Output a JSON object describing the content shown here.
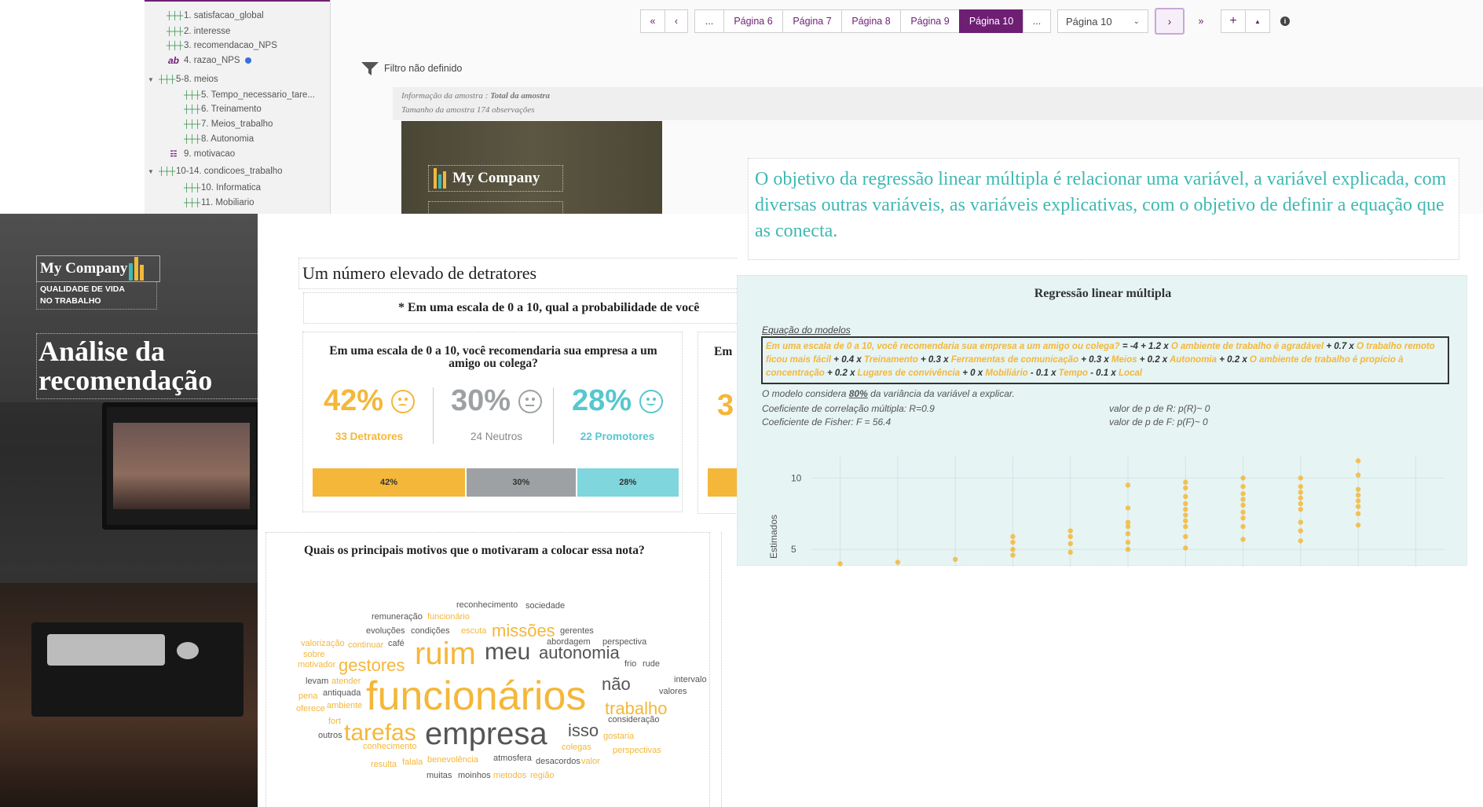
{
  "tree": {
    "items": [
      {
        "icon": "scale-icon",
        "label": "1. satisfacao_global"
      },
      {
        "icon": "scale-icon",
        "label": "2. interesse"
      },
      {
        "icon": "scale-icon",
        "label": "3. recomendacao_NPS"
      },
      {
        "icon": "text-icon",
        "label": "4. razao_NPS"
      },
      {
        "icon": "scale-icon",
        "label": "5-8. meios",
        "toggle": "▼"
      },
      {
        "icon": "scale-icon",
        "label": "5. Tempo_necessario_tare..."
      },
      {
        "icon": "scale-icon",
        "label": "6. Treinamento"
      },
      {
        "icon": "scale-icon",
        "label": "7. Meios_trabalho"
      },
      {
        "icon": "scale-icon",
        "label": "8. Autonomia"
      },
      {
        "icon": "multi-choice-icon",
        "label": "9. motivacao"
      },
      {
        "icon": "scale-icon",
        "label": "10-14. condicoes_trabalho",
        "toggle": "▼"
      },
      {
        "icon": "scale-icon",
        "label": "10. Informatica"
      },
      {
        "icon": "scale-icon",
        "label": "11. Mobiliario"
      }
    ]
  },
  "pager": {
    "first": "«",
    "prev": "‹",
    "ellipsis_left": "...",
    "pages": [
      "Página 6",
      "Página 7",
      "Página 8",
      "Página 9",
      "Página 10"
    ],
    "active_index": 4,
    "ellipsis_right": "...",
    "select_value": "Página 10",
    "next": "›",
    "last": "»",
    "add": "+",
    "collapse": "▲",
    "info": "i"
  },
  "filter": {
    "label": "Filtro não definido"
  },
  "sample": {
    "info_prefix": "Informação da amostra :",
    "info_value": "Total da amostra",
    "size": "Tamanho da amostra 174 observações"
  },
  "brand": {
    "company": "My Company",
    "sub_line1": "QUALIDADE DE VIDA",
    "sub_line2": "NO TRABALHO",
    "colors": [
      "#f4b73a",
      "#3fb9b3",
      "#6e1f74"
    ]
  },
  "cover": {
    "title": "Análise da recomendação"
  },
  "report": {
    "section_title": "Um número elevado de detratores",
    "question_full": "* Em uma escala de 0 a 10, qual a probabilidade de você",
    "nps": {
      "question": "Em uma escala de 0 a 10, você recomendaria sua empresa a um amigo ou colega?",
      "detractors": {
        "pct": "42%",
        "label": "33 Detratores",
        "value": 42,
        "color": "#f4b73a"
      },
      "neutrals": {
        "pct": "30%",
        "label": "24 Neutros",
        "value": 30,
        "color": "#9ea1a3"
      },
      "promoters": {
        "pct": "28%",
        "label": "22 Promotores",
        "value": 28,
        "color": "#7fd6dc"
      }
    },
    "cut_card": {
      "title": "Em",
      "number": "3"
    },
    "wordcloud_title": "Quais os principais motivos que o motivaram a colocar essa nota?",
    "words": [
      {
        "t": "reconhecimento",
        "c": "g",
        "s": 11
      },
      {
        "t": "sociedade",
        "c": "g",
        "s": 11
      },
      {
        "t": "remuneração",
        "c": "g",
        "s": 11
      },
      {
        "t": "funcionário",
        "c": "y",
        "s": 11
      },
      {
        "t": "evoluções",
        "c": "g",
        "s": 11
      },
      {
        "t": "condições",
        "c": "g",
        "s": 11
      },
      {
        "t": "escuta",
        "c": "y",
        "s": 11
      },
      {
        "t": "missões",
        "c": "y",
        "s": 22
      },
      {
        "t": "gerentes",
        "c": "g",
        "s": 11
      },
      {
        "t": "abordagem",
        "c": "g",
        "s": 11
      },
      {
        "t": "perspectiva",
        "c": "g",
        "s": 11
      },
      {
        "t": "valorização",
        "c": "y",
        "s": 11
      },
      {
        "t": "continuar",
        "c": "y",
        "s": 11
      },
      {
        "t": "café",
        "c": "g",
        "s": 11
      },
      {
        "t": "ruim",
        "c": "y",
        "s": 40
      },
      {
        "t": "meu",
        "c": "g",
        "s": 30
      },
      {
        "t": "autonomia",
        "c": "g",
        "s": 22
      },
      {
        "t": "sobre",
        "c": "y",
        "s": 11
      },
      {
        "t": "motivador",
        "c": "y",
        "s": 11
      },
      {
        "t": "gestores",
        "c": "y",
        "s": 22
      },
      {
        "t": "frio",
        "c": "g",
        "s": 11
      },
      {
        "t": "rude",
        "c": "g",
        "s": 11
      },
      {
        "t": "levam",
        "c": "g",
        "s": 11
      },
      {
        "t": "atender",
        "c": "y",
        "s": 11
      },
      {
        "t": "funcionários",
        "c": "y",
        "s": 52
      },
      {
        "t": "não",
        "c": "g",
        "s": 22
      },
      {
        "t": "intervalo",
        "c": "g",
        "s": 11
      },
      {
        "t": "pena",
        "c": "y",
        "s": 11
      },
      {
        "t": "antiquada",
        "c": "g",
        "s": 11
      },
      {
        "t": "valores",
        "c": "g",
        "s": 11
      },
      {
        "t": "oferece",
        "c": "y",
        "s": 11
      },
      {
        "t": "ambiente",
        "c": "y",
        "s": 11
      },
      {
        "t": "trabalho",
        "c": "y",
        "s": 22
      },
      {
        "t": "fort",
        "c": "y",
        "s": 11
      },
      {
        "t": "outros",
        "c": "g",
        "s": 11
      },
      {
        "t": "tarefas",
        "c": "y",
        "s": 30
      },
      {
        "t": "empresa",
        "c": "g",
        "s": 40
      },
      {
        "t": "isso",
        "c": "g",
        "s": 22
      },
      {
        "t": "consideração",
        "c": "g",
        "s": 11
      },
      {
        "t": "gostaria",
        "c": "y",
        "s": 11
      },
      {
        "t": "conhecimento",
        "c": "y",
        "s": 11
      },
      {
        "t": "colegas",
        "c": "y",
        "s": 11
      },
      {
        "t": "perspectivas",
        "c": "y",
        "s": 11
      },
      {
        "t": "benevolência",
        "c": "y",
        "s": 11
      },
      {
        "t": "atmosfera",
        "c": "g",
        "s": 11
      },
      {
        "t": "resulta",
        "c": "y",
        "s": 11
      },
      {
        "t": "falala",
        "c": "y",
        "s": 11
      },
      {
        "t": "desacordos",
        "c": "g",
        "s": 11
      },
      {
        "t": "valor",
        "c": "y",
        "s": 11
      },
      {
        "t": "muitas",
        "c": "g",
        "s": 11
      },
      {
        "t": "moinhos",
        "c": "g",
        "s": 11
      },
      {
        "t": "metodos",
        "c": "y",
        "s": 11
      },
      {
        "t": "região",
        "c": "y",
        "s": 11
      }
    ]
  },
  "regression": {
    "intro": "O objetivo da regressão linear múltipla é relacionar uma variável, a variável explicada, com diversas outras variáveis, as variáveis explicativas, com o objetivo de definir a equação que as conecta.",
    "title": "Regressão linear múltipla",
    "eq_label": "Equação do modelos",
    "eq": [
      {
        "t": "Em uma escala de 0 a 10, você recomendaria sua empresa a um amigo ou colega?",
        "k": "hl"
      },
      {
        "t": " = -4 + 1.2 x ",
        "k": "dk"
      },
      {
        "t": "O ambiente de trabalho é agradável",
        "k": "hl"
      },
      {
        "t": " + 0.7 x ",
        "k": "dk"
      },
      {
        "t": "O trabalho remoto ficou mais fácil",
        "k": "hl"
      },
      {
        "t": " + 0.4 x ",
        "k": "dk"
      },
      {
        "t": "Treinamento",
        "k": "hl"
      },
      {
        "t": " + 0.3 x ",
        "k": "dk"
      },
      {
        "t": "Ferramentas de comunicação",
        "k": "hl"
      },
      {
        "t": " + 0.3 x ",
        "k": "dk"
      },
      {
        "t": "Meios",
        "k": "hl"
      },
      {
        "t": " + 0.2 x ",
        "k": "dk"
      },
      {
        "t": "Autonomia",
        "k": "hl"
      },
      {
        "t": " + 0.2 x ",
        "k": "dk"
      },
      {
        "t": "O ambiente de trabalho é propício à concentração",
        "k": "hl"
      },
      {
        "t": " + 0.2 x ",
        "k": "dk"
      },
      {
        "t": "Lugares de convivência",
        "k": "hl"
      },
      {
        "t": " + 0 x ",
        "k": "dk"
      },
      {
        "t": "Mobiliário",
        "k": "hl"
      },
      {
        "t": " - 0.1 x ",
        "k": "dk"
      },
      {
        "t": "Tempo",
        "k": "hl"
      },
      {
        "t": " - 0.1 x ",
        "k": "dk"
      },
      {
        "t": "Local",
        "k": "hl"
      }
    ],
    "variance_prefix": "O modelo considera ",
    "variance_value": "80%",
    "variance_suffix": " da variância da variável a explicar.",
    "r_coef": "Coeficiente de correlação múltipla: R=0.9",
    "f_coef": "Coeficiente de Fisher: F = 56.4",
    "p_r": "valor de p de R: p(R)~ 0",
    "p_f": "valor de p de F: p(F)~ 0"
  },
  "chart_data": {
    "type": "scatter",
    "title": "",
    "xlabel": "",
    "ylabel": "Estimados",
    "ylim": [
      3.8,
      11.5
    ],
    "xlim": [
      -0.5,
      10.5
    ],
    "yticks": [
      5,
      10
    ],
    "grid": true,
    "color": "#f4b73a",
    "points": [
      [
        0,
        4.0
      ],
      [
        1,
        4.1
      ],
      [
        2,
        4.3
      ],
      [
        3,
        4.6
      ],
      [
        3,
        5.0
      ],
      [
        3,
        5.5
      ],
      [
        3,
        5.9
      ],
      [
        4,
        4.8
      ],
      [
        4,
        5.4
      ],
      [
        4,
        5.9
      ],
      [
        4,
        6.3
      ],
      [
        5,
        5.0
      ],
      [
        5,
        5.5
      ],
      [
        5,
        6.1
      ],
      [
        5,
        6.6
      ],
      [
        5,
        6.9
      ],
      [
        5,
        7.9
      ],
      [
        5,
        9.5
      ],
      [
        6,
        5.1
      ],
      [
        6,
        5.9
      ],
      [
        6,
        6.6
      ],
      [
        6,
        7.0
      ],
      [
        6,
        7.4
      ],
      [
        6,
        7.8
      ],
      [
        6,
        8.2
      ],
      [
        6,
        8.7
      ],
      [
        6,
        9.3
      ],
      [
        6,
        9.7
      ],
      [
        7,
        5.7
      ],
      [
        7,
        6.6
      ],
      [
        7,
        7.2
      ],
      [
        7,
        7.6
      ],
      [
        7,
        8.1
      ],
      [
        7,
        8.5
      ],
      [
        7,
        8.9
      ],
      [
        7,
        9.4
      ],
      [
        7,
        10.0
      ],
      [
        8,
        5.6
      ],
      [
        8,
        6.3
      ],
      [
        8,
        6.9
      ],
      [
        8,
        7.8
      ],
      [
        8,
        8.2
      ],
      [
        8,
        8.6
      ],
      [
        8,
        9.0
      ],
      [
        8,
        9.4
      ],
      [
        8,
        10.0
      ],
      [
        9,
        6.7
      ],
      [
        9,
        7.5
      ],
      [
        9,
        8.0
      ],
      [
        9,
        8.4
      ],
      [
        9,
        8.8
      ],
      [
        9,
        9.2
      ],
      [
        9,
        11.2
      ],
      [
        9,
        10.2
      ]
    ]
  }
}
